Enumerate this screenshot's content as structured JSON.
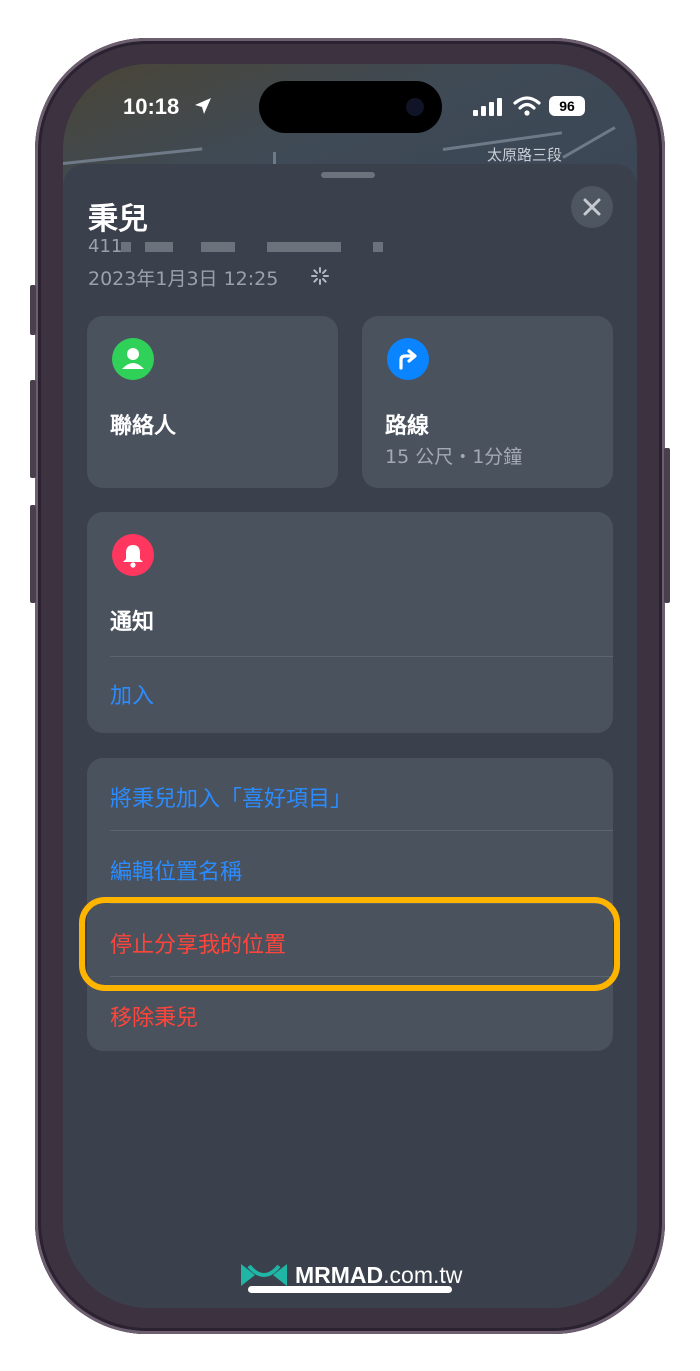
{
  "status_bar": {
    "time": "10:18",
    "battery": "96",
    "icons": [
      "location-arrow-icon",
      "signal-bars-icon",
      "wifi-icon",
      "battery-icon"
    ]
  },
  "map": {
    "street_label": "太原路三段"
  },
  "sheet": {
    "title": "秉兒",
    "address_prefix": "411",
    "timestamp": "2023年1月3日 12:25"
  },
  "cards": {
    "contact": {
      "label": "聯絡人",
      "icon": "person-icon",
      "icon_color": "#30d158"
    },
    "directions": {
      "label": "路線",
      "detail": "15 公尺・1分鐘",
      "icon": "turn-arrow-icon",
      "icon_color": "#0a84ff"
    },
    "notifications": {
      "label": "通知",
      "add_label": "加入",
      "icon": "bell-icon",
      "icon_color": "#ff375f"
    }
  },
  "actions": [
    {
      "label": "將秉兒加入「喜好項目」",
      "color": "#2b8cff"
    },
    {
      "label": "編輯位置名稱",
      "color": "#2b8cff"
    },
    {
      "label": "停止分享我的位置",
      "color": "#ff453a"
    },
    {
      "label": "移除秉兒",
      "color": "#ff453a"
    }
  ],
  "watermark": {
    "brand": "MRMAD",
    "domain": ".com.tw"
  },
  "colors": {
    "highlight": "#ffb400",
    "accent_blue": "#2b8cff",
    "destructive_red": "#ff453a"
  }
}
